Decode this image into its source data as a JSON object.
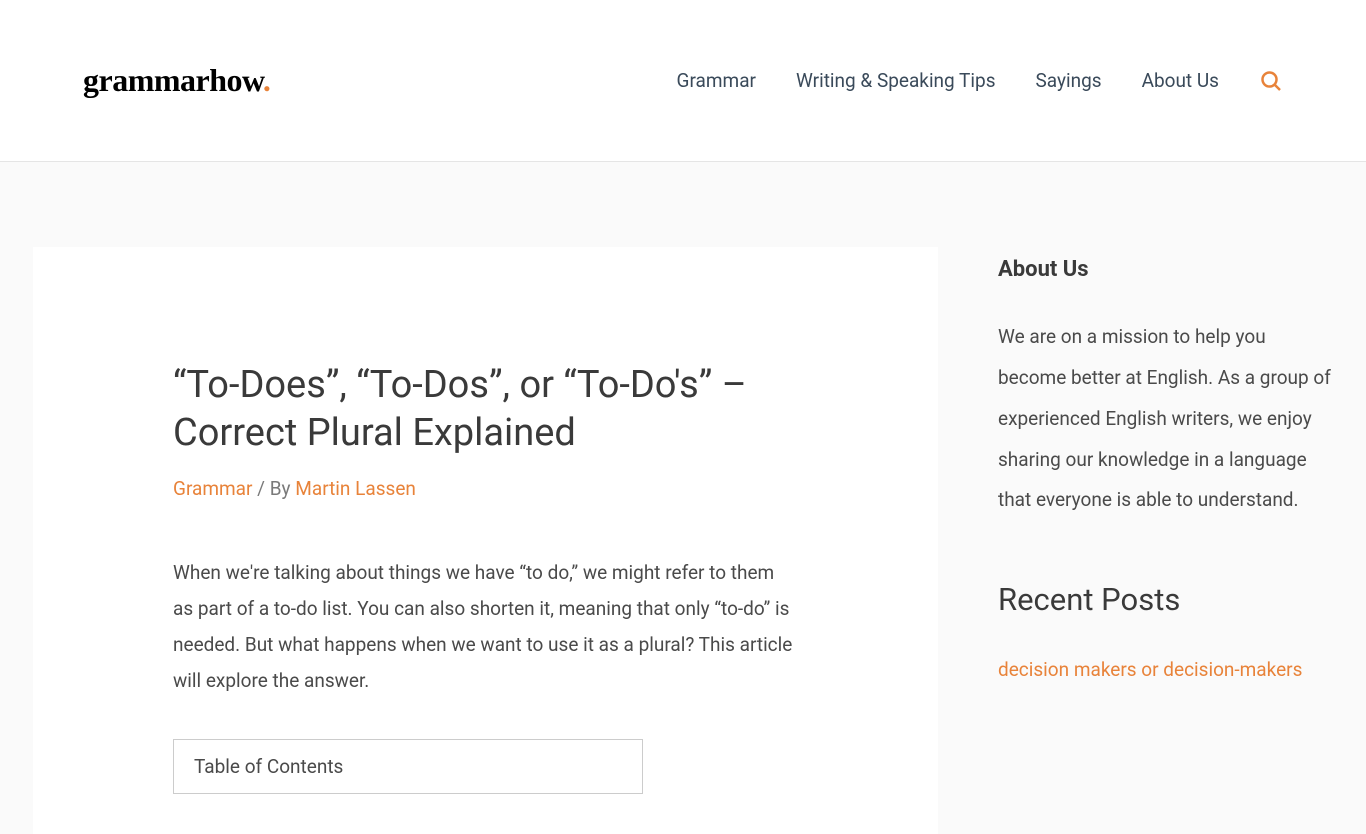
{
  "logo": {
    "text": "grammarhow",
    "dot": "."
  },
  "nav": {
    "items": [
      "Grammar",
      "Writing & Speaking Tips",
      "Sayings",
      "About Us"
    ]
  },
  "article": {
    "title": "“To-Does”, “To-Dos”, or “To-Do's” – Correct Plural Explained",
    "category": "Grammar",
    "separator": " / By ",
    "author": "Martin Lassen",
    "body": "When we're talking about things we have “to do,” we might refer to them as part of a to-do list. You can also shorten it, meaning that only “to-do” is needed. But what happens when we want to use it as a plural? This article will explore the answer.",
    "toc_title": "Table of Contents"
  },
  "sidebar": {
    "about_heading": "About Us",
    "about_text": "We are on a mission to help you become better at English. As a group of experienced English writers, we enjoy sharing our knowledge in a language that everyone is able to understand.",
    "recent_heading": "Recent Posts",
    "recent_link": "decision makers or decision-makers"
  }
}
